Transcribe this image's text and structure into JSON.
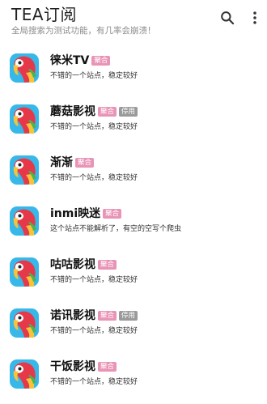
{
  "appbar": {
    "title": "TEA订阅",
    "subtitle": "全局搜索为测试功能，有几率会崩溃！",
    "icons": [
      "search-icon",
      "more-vert-icon"
    ]
  },
  "colors": {
    "avatar_bg": "#37b8e8",
    "badge_pink": "#e994b6",
    "badge_gray": "#9a9a9a"
  },
  "subscriptions": [
    {
      "name": "徕米TV",
      "badges": [
        "聚合"
      ],
      "desc": "不错的一个站点，稳定较好"
    },
    {
      "name": "蘑菇影视",
      "badges": [
        "聚合",
        "停用"
      ],
      "desc": "不错的一个站点，稳定较好"
    },
    {
      "name": "渐渐",
      "badges": [
        "聚合"
      ],
      "desc": "不错的一个站点，稳定较好"
    },
    {
      "name": "inmi映迷",
      "badges": [
        "聚合"
      ],
      "desc": "这个站点不能解析了，有空的空写个爬虫"
    },
    {
      "name": "咕咕影视",
      "badges": [
        "聚合"
      ],
      "desc": "不错的一个站点，稳定较好"
    },
    {
      "name": "诺讯影视",
      "badges": [
        "聚合",
        "停用"
      ],
      "desc": "不错的一个站点，稳定较好"
    },
    {
      "name": "干饭影视",
      "badges": [
        "聚合"
      ],
      "desc": "不错的一个站点，稳定较好"
    }
  ]
}
